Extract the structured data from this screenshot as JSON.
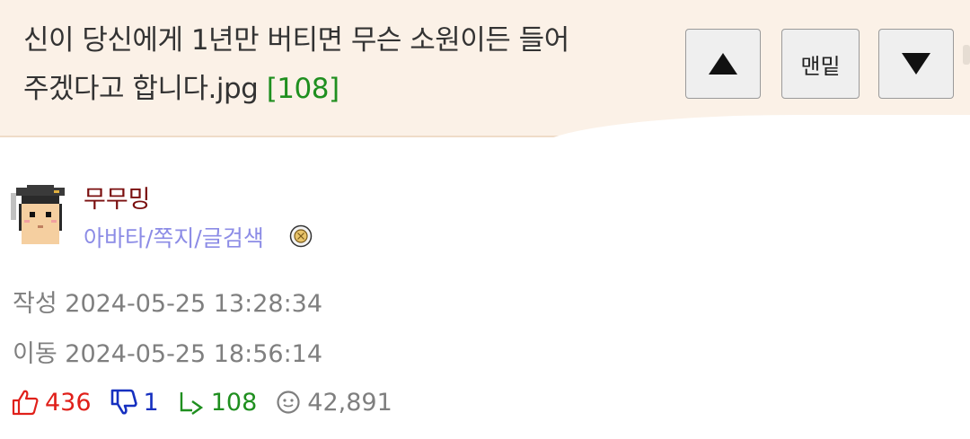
{
  "header": {
    "title": "신이 당신에게 1년만 버티면 무슨 소원이든 들어",
    "title_line2": "주겠다고 합니다.jpg",
    "reply_count": "[108]",
    "buttons": {
      "up_icon": "triangle-up-icon",
      "bottom_label": "맨밑",
      "down_icon": "triangle-down-icon"
    }
  },
  "author": {
    "name": "무무밍",
    "links": "아바타/쪽지/글검색",
    "avatar_icon": "graduate-avatar-icon",
    "badge_icon": "medal-icon"
  },
  "meta": {
    "created": "작성 2024-05-25 13:28:34",
    "moved": "이동 2024-05-25 18:56:14"
  },
  "stats": {
    "upvotes": "436",
    "downvotes": "1",
    "replies": "108",
    "views": "42,891"
  },
  "colors": {
    "header_bg": "#fbf1e7",
    "upvote": "#e0201a",
    "downvote": "#1630c0",
    "reply": "#1f8f1f",
    "username": "#7a0e0e",
    "links": "#8c8ce6"
  }
}
